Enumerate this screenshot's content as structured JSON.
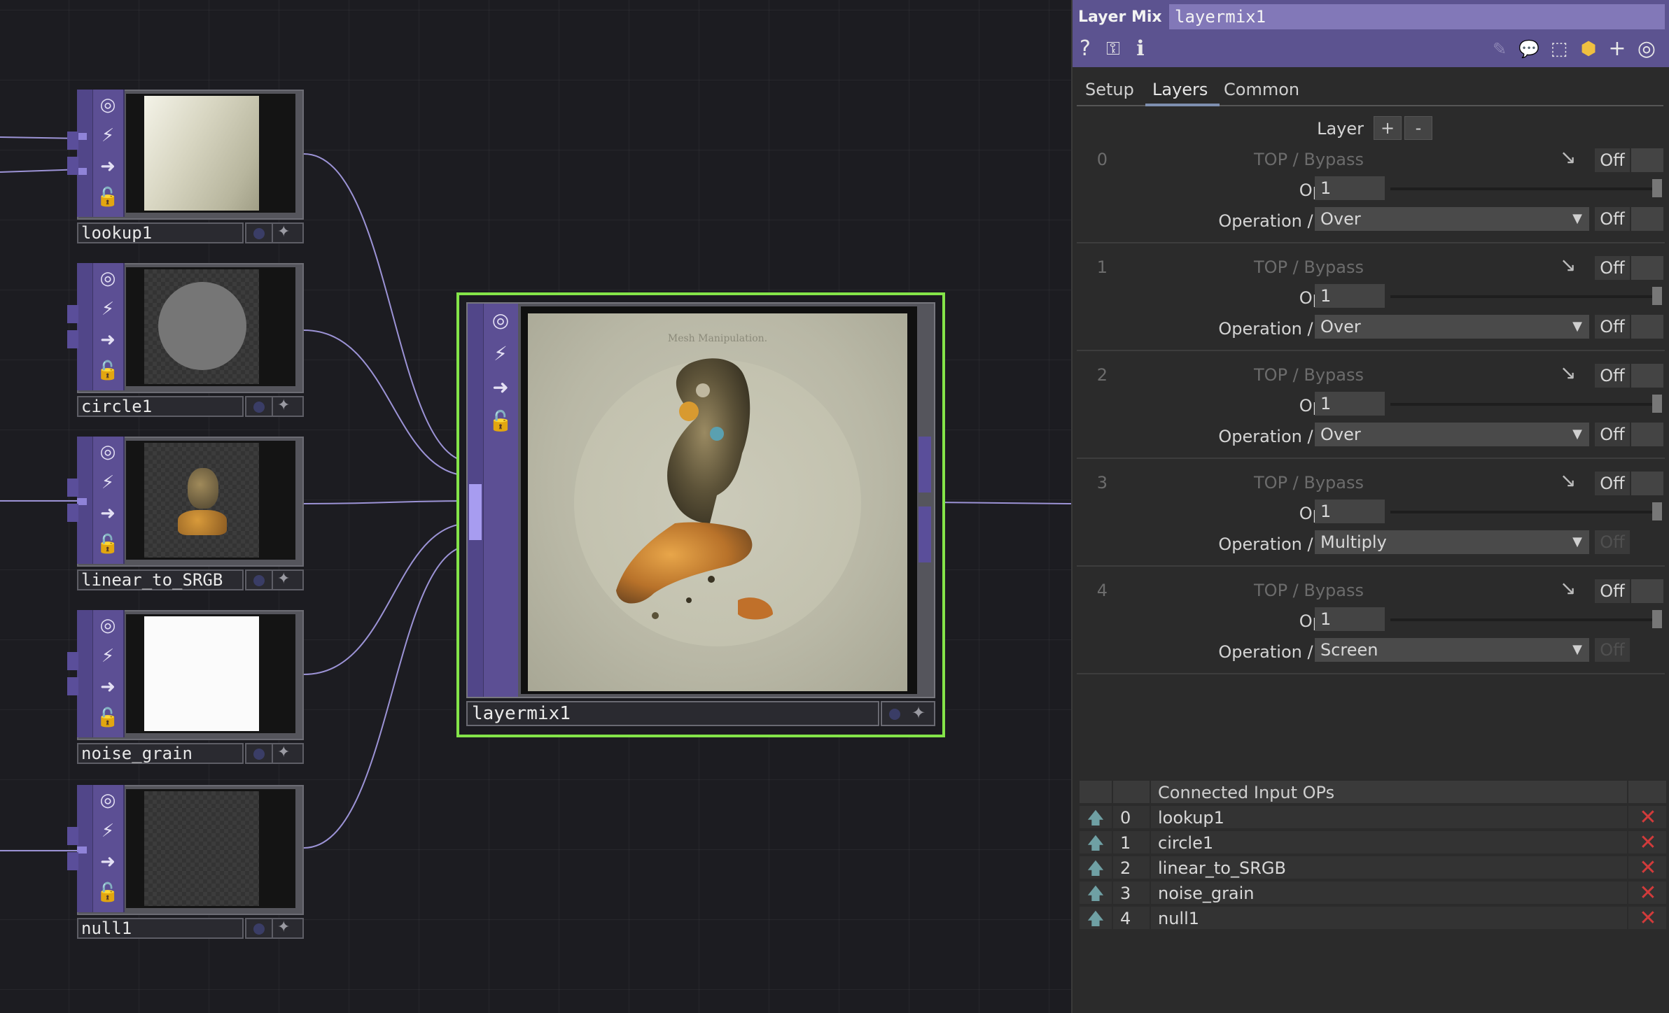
{
  "nodes": [
    {
      "name": "lookup1"
    },
    {
      "name": "circle1"
    },
    {
      "name": "linear_to_SRGB"
    },
    {
      "name": "noise_grain"
    },
    {
      "name": "null1"
    }
  ],
  "main_node": {
    "name": "layermix1",
    "preview_caption": "Mesh Manipulation."
  },
  "panel": {
    "op_type": "Layer Mix",
    "op_name": "layermix1",
    "tabs": [
      "Setup",
      "Layers",
      "Common"
    ],
    "layer_label": "Layer",
    "add_label": "+",
    "remove_label": "-",
    "layers": [
      {
        "index": "0",
        "top_label": "TOP / Bypass",
        "bypass": "Off",
        "opacity_label": "Opacity",
        "opacity": "1",
        "op_label": "Operation / Swap",
        "operation": "Over",
        "swap": "Off"
      },
      {
        "index": "1",
        "top_label": "TOP / Bypass",
        "bypass": "Off",
        "opacity_label": "Opacity",
        "opacity": "1",
        "op_label": "Operation / Swap",
        "operation": "Over",
        "swap": "Off"
      },
      {
        "index": "2",
        "top_label": "TOP / Bypass",
        "bypass": "Off",
        "opacity_label": "Opacity",
        "opacity": "1",
        "op_label": "Operation / Swap",
        "operation": "Over",
        "swap": "Off"
      },
      {
        "index": "3",
        "top_label": "TOP / Bypass",
        "bypass": "Off",
        "opacity_label": "Opacity",
        "opacity": "1",
        "op_label": "Operation / Swap",
        "operation": "Multiply",
        "swap": "Off"
      },
      {
        "index": "4",
        "top_label": "TOP / Bypass",
        "bypass": "Off",
        "opacity_label": "Opacity",
        "opacity": "1",
        "op_label": "Operation / Swap",
        "operation": "Screen",
        "swap": "Off"
      }
    ],
    "inputs_header": "Connected Input OPs",
    "inputs": [
      {
        "index": "0",
        "name": "lookup1"
      },
      {
        "index": "1",
        "name": "circle1"
      },
      {
        "index": "2",
        "name": "linear_to_SRGB"
      },
      {
        "index": "3",
        "name": "noise_grain"
      },
      {
        "index": "4",
        "name": "null1"
      }
    ]
  },
  "colors": {
    "accent": "#5c5390",
    "selected": "#84e449",
    "node_strip": "#5c4f94",
    "delete": "#d23b3b"
  }
}
